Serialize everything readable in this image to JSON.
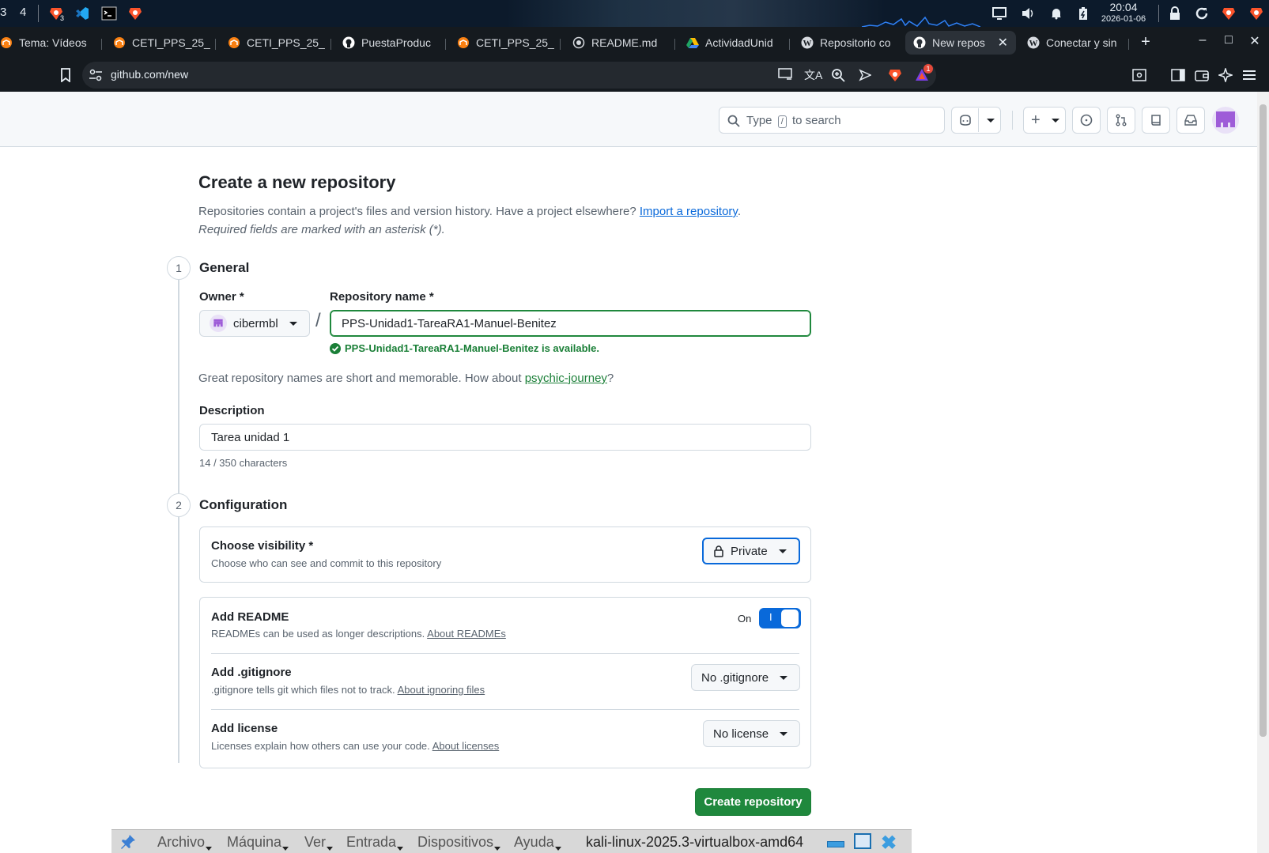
{
  "os_panel": {
    "workspace_left": "3",
    "workspace_current": "4",
    "brave_badge": "3",
    "time": "20:04",
    "date": "2026-01-06"
  },
  "tabs": [
    {
      "label": "Tema: Vídeos",
      "icon": "moodle-icon"
    },
    {
      "label": "CETI_PPS_25_",
      "icon": "moodle-icon"
    },
    {
      "label": "CETI_PPS_25_",
      "icon": "moodle-icon"
    },
    {
      "label": "PuestaProduc",
      "icon": "github-icon"
    },
    {
      "label": "CETI_PPS_25_",
      "icon": "moodle-icon"
    },
    {
      "label": "README.md",
      "icon": "globe-icon"
    },
    {
      "label": "ActividadUnid",
      "icon": "drive-icon"
    },
    {
      "label": "Repositorio co",
      "icon": "wordpress-icon"
    },
    {
      "label": "New repos",
      "icon": "github-icon",
      "active": true
    },
    {
      "label": "Conectar y sin",
      "icon": "wordpress-icon"
    }
  ],
  "address": {
    "url": "github.com/new",
    "alert_count": "1"
  },
  "github_header": {
    "search_prefix": "Type",
    "search_key": "/",
    "search_suffix": "to search"
  },
  "page": {
    "title": "Create a new repository",
    "intro_text": "Repositories contain a project's files and version history. Have a project elsewhere?",
    "import_link": "Import a repository",
    "intro_end": ".",
    "required_note": "Required fields are marked with an asterisk (*).",
    "general": {
      "step": "1",
      "heading": "General",
      "owner_label": "Owner *",
      "owner_value": "cibermbl",
      "separator": "/",
      "repo_label": "Repository name *",
      "repo_value": "PPS-Unidad1-TareaRA1-Manuel-Benitez",
      "available_msg": "PPS-Unidad1-TareaRA1-Manuel-Benitez is available.",
      "suggestion_text": "Great repository names are short and memorable. How about",
      "suggestion_link": "psychic-journey",
      "suggestion_end": "?",
      "description_label": "Description",
      "description_value": "Tarea unidad 1",
      "char_count": "14 / 350 characters"
    },
    "configuration": {
      "step": "2",
      "heading": "Configuration",
      "visibility_title": "Choose visibility *",
      "visibility_desc": "Choose who can see and commit to this repository",
      "visibility_value": "Private",
      "readme_title": "Add README",
      "readme_desc": "READMEs can be used as longer descriptions.",
      "readme_link": "About READMEs",
      "readme_toggle_label": "On",
      "readme_toggle_glyph": "I",
      "gitignore_title": "Add .gitignore",
      "gitignore_desc": ".gitignore tells git which files not to track.",
      "gitignore_link": "About ignoring files",
      "gitignore_value": "No .gitignore",
      "license_title": "Add license",
      "license_desc": "Licenses explain how others can use your code.",
      "license_link": "About licenses",
      "license_value": "No license"
    },
    "create_button": "Create repository"
  },
  "vbox": {
    "menus": [
      "Archivo",
      "Máquina",
      "Ver",
      "Entrada",
      "Dispositivos",
      "Ayuda"
    ],
    "vm_title": "kali-linux-2025.3-virtualbox-amd64"
  },
  "colors": {
    "primary_green": "#1f883d",
    "link_blue": "#0969da",
    "brave_orange": "#fb542b",
    "toggle_blue": "#0969da"
  }
}
